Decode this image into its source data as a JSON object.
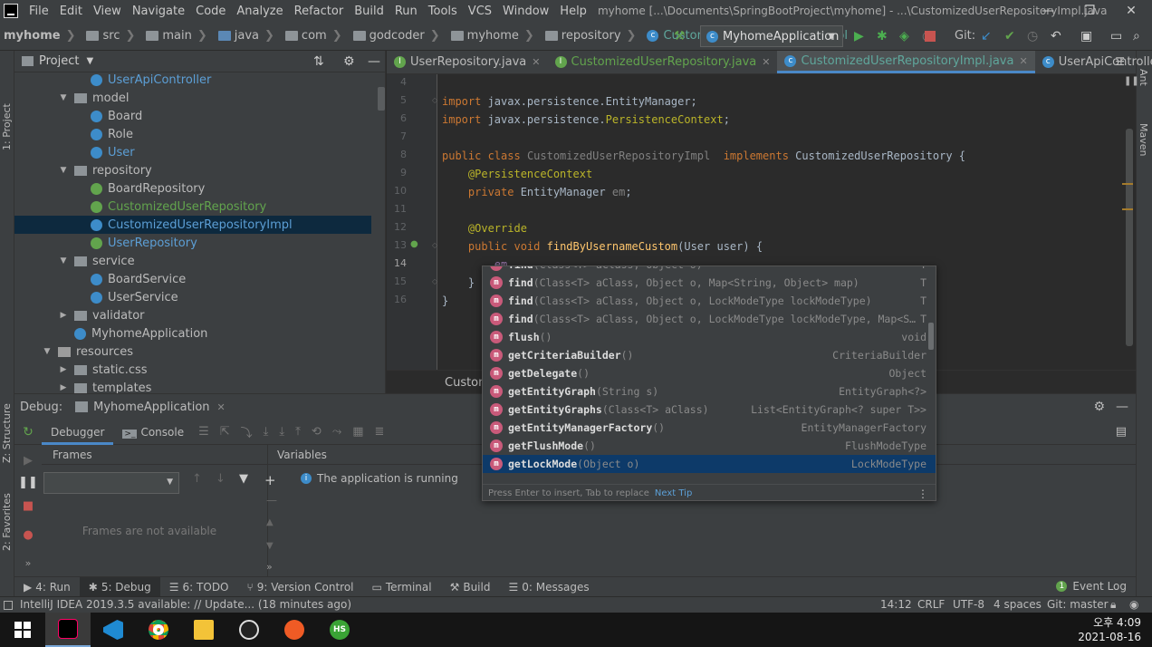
{
  "menubar": {
    "items": [
      "File",
      "Edit",
      "View",
      "Navigate",
      "Code",
      "Analyze",
      "Refactor",
      "Build",
      "Run",
      "Tools",
      "VCS",
      "Window",
      "Help"
    ],
    "title": "myhome [...\\Documents\\SpringBootProject\\myhome] - ...\\CustomizedUserRepositoryImpl.java"
  },
  "navbar": {
    "crumbs": [
      "myhome",
      "src",
      "main",
      "java",
      "com",
      "godcoder",
      "myhome",
      "repository",
      "CustomizedUserRepositoryImpl"
    ],
    "run_config": "MyhomeApplication",
    "git_label": "Git:"
  },
  "left_stripe": {
    "project": "1: Project",
    "structure": "Z: Structure",
    "favorites": "2: Favorites"
  },
  "right_stripe": {
    "ant": "Ant",
    "maven": "Maven"
  },
  "project_panel": {
    "title": "Project",
    "rows": [
      {
        "label": "UserApiController",
        "kind": "class",
        "color": "link",
        "depth": 3
      },
      {
        "label": "model",
        "kind": "folder",
        "depth": 2,
        "expanded": true
      },
      {
        "label": "Board",
        "kind": "class",
        "depth": 3
      },
      {
        "label": "Role",
        "kind": "class",
        "depth": 3
      },
      {
        "label": "User",
        "kind": "class",
        "color": "link",
        "depth": 3
      },
      {
        "label": "repository",
        "kind": "folder",
        "depth": 2,
        "expanded": true
      },
      {
        "label": "BoardRepository",
        "kind": "interface",
        "depth": 3
      },
      {
        "label": "CustomizedUserRepository",
        "kind": "interface",
        "color": "green",
        "depth": 3
      },
      {
        "label": "CustomizedUserRepositoryImpl",
        "kind": "class",
        "color": "link",
        "depth": 3,
        "selected": true
      },
      {
        "label": "UserRepository",
        "kind": "interface",
        "color": "link",
        "depth": 3
      },
      {
        "label": "service",
        "kind": "folder",
        "depth": 2,
        "expanded": true
      },
      {
        "label": "BoardService",
        "kind": "class",
        "depth": 3
      },
      {
        "label": "UserService",
        "kind": "class",
        "depth": 3
      },
      {
        "label": "validator",
        "kind": "folder",
        "depth": 2,
        "expanded": false
      },
      {
        "label": "MyhomeApplication",
        "kind": "class",
        "depth": 2
      },
      {
        "label": "resources",
        "kind": "resfolder",
        "depth": 1,
        "expanded": true
      },
      {
        "label": "static.css",
        "kind": "folder",
        "depth": 2,
        "expanded": false
      },
      {
        "label": "templates",
        "kind": "folder",
        "depth": 2,
        "expanded": false
      }
    ]
  },
  "editor": {
    "tabs": [
      {
        "label": "UserRepository.java",
        "kind": "interface",
        "active": false
      },
      {
        "label": "CustomizedUserRepository.java",
        "kind": "interface",
        "active": false
      },
      {
        "label": "CustomizedUserRepositoryImpl.java",
        "kind": "class",
        "active": true
      },
      {
        "label": "UserApiController.java",
        "kind": "class",
        "active": false
      }
    ],
    "line_numbers": [
      "4",
      "5",
      "6",
      "7",
      "8",
      "9",
      "10",
      "11",
      "12",
      "13",
      "14",
      "15",
      "16"
    ],
    "current_line": "14",
    "breadcrumb_status": "Customi"
  },
  "completion": {
    "items": [
      {
        "name": "find",
        "params": "(Class<T> aClass, Object o)",
        "type": "T"
      },
      {
        "name": "find",
        "params": "(Class<T> aClass, Object o, Map<String, Object> map)",
        "type": "T"
      },
      {
        "name": "find",
        "params": "(Class<T> aClass, Object o, LockModeType lockModeType)",
        "type": "T"
      },
      {
        "name": "find",
        "params": "(Class<T> aClass, Object o, LockModeType lockModeType, Map<S…",
        "type": "T"
      },
      {
        "name": "flush",
        "params": "()",
        "type": "void"
      },
      {
        "name": "getCriteriaBuilder",
        "params": "()",
        "type": "CriteriaBuilder"
      },
      {
        "name": "getDelegate",
        "params": "()",
        "type": "Object"
      },
      {
        "name": "getEntityGraph",
        "params": "(String s)",
        "type": "EntityGraph<?>"
      },
      {
        "name": "getEntityGraphs",
        "params": "(Class<T> aClass)",
        "type": "List<EntityGraph<? super T>>"
      },
      {
        "name": "getEntityManagerFactory",
        "params": "()",
        "type": "EntityManagerFactory"
      },
      {
        "name": "getFlushMode",
        "params": "()",
        "type": "FlushModeType"
      },
      {
        "name": "getLockMode",
        "params": "(Object o)",
        "type": "LockModeType",
        "selected": true
      }
    ],
    "icon_letter": "m",
    "footer": "Press Enter to insert, Tab to replace",
    "next_tip": "Next Tip"
  },
  "debug": {
    "label": "Debug:",
    "config": "MyhomeApplication",
    "tabs": [
      "Debugger",
      "Console"
    ],
    "frames_header": "Frames",
    "frames_empty": "Frames are not available",
    "variables_header": "Variables",
    "running_msg": "The application is running"
  },
  "bottom_tools": [
    {
      "label": "4: Run",
      "active": false
    },
    {
      "label": "5: Debug",
      "active": true
    },
    {
      "label": "6: TODO",
      "active": false
    },
    {
      "label": "9: Version Control",
      "active": false
    },
    {
      "label": "Terminal",
      "active": false
    },
    {
      "label": "Build",
      "active": false
    },
    {
      "label": "0: Messages",
      "active": false
    }
  ],
  "event_log": "Event Log",
  "statusbar": {
    "message": "IntelliJ IDEA 2019.3.5 available: // Update... (18 minutes ago)",
    "position": "14:12",
    "line_sep": "CRLF",
    "encoding": "UTF-8",
    "indent": "4 spaces",
    "git": "Git: master"
  },
  "taskbar": {
    "time": "오후 4:09",
    "date": "2021-08-16"
  }
}
